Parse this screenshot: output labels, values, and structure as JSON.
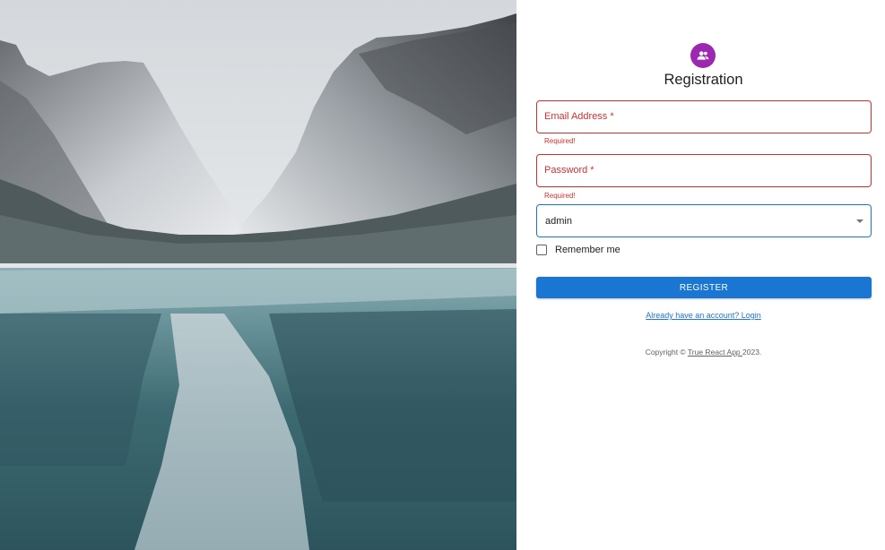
{
  "form": {
    "title": "Registration",
    "email": {
      "label": "Email Address",
      "required_mark": "*",
      "helper": "Required!"
    },
    "password": {
      "label": "Password",
      "required_mark": "*",
      "helper": "Required!"
    },
    "role": {
      "value": "admin"
    },
    "remember": {
      "label": "Remember me",
      "checked": false
    },
    "register_label": "REGISTER",
    "login_link": "Already have an account? Login"
  },
  "footer": {
    "prefix": "Copyright © ",
    "app_name": "True React App ",
    "year": "2023."
  },
  "icons": {
    "avatar": "people-icon",
    "select_caret": "caret-down-icon"
  },
  "colors": {
    "avatar_bg": "#9c27b0",
    "error": "#d32f2f",
    "primary": "#1976d2"
  }
}
